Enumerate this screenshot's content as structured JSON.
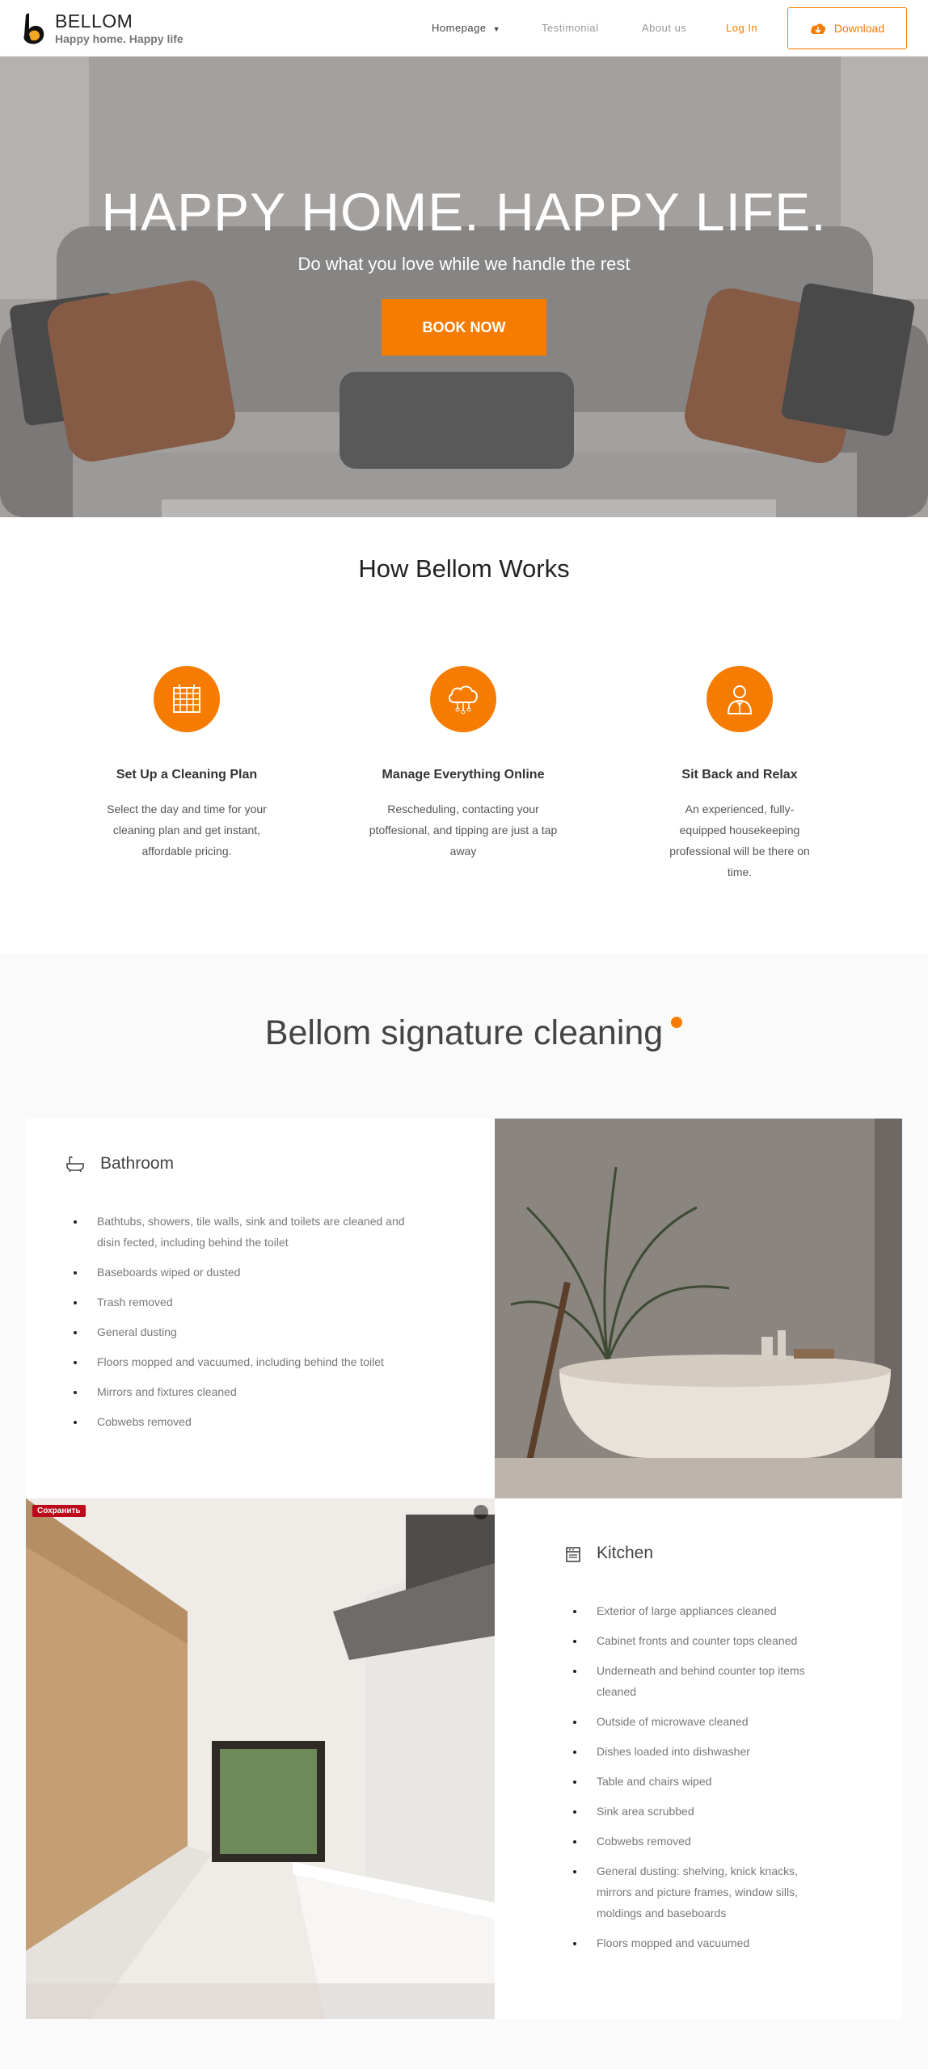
{
  "header": {
    "brand_name": "BELLOM",
    "brand_tagline": "Happy home. Happy life",
    "nav": [
      "Homepage",
      "Testimonial",
      "About us",
      "Log In"
    ],
    "download_label": "Download"
  },
  "hero": {
    "title": "HAPPY HOME. HAPPY LIFE.",
    "subtitle": "Do what you love while we handle the rest",
    "button": "BOOK NOW"
  },
  "how": {
    "title": "How Bellom Works",
    "steps": [
      {
        "icon": "calendar-icon",
        "title": "Set Up a Cleaning Plan",
        "text": "Select the day and time for your cleaning plan and get instant, affordable pricing."
      },
      {
        "icon": "cloud-icon",
        "title": "Manage Everything Online",
        "text": "Rescheduling, contacting your ptoffesional, and tipping are just a tap away"
      },
      {
        "icon": "person-icon",
        "title": "Sit Back and Relax",
        "text": "An experienced, fully-equipped housekeeping professional will be there on time."
      }
    ]
  },
  "signature": {
    "title": "Bellom signature cleaning",
    "bathroom": {
      "title": "Bathroom",
      "icon": "bathtub-icon",
      "items": [
        "Bathtubs, showers, tile walls, sink and toilets are cleaned and disin fected, including behind the toilet",
        "Baseboards wiped or dusted",
        "Trash removed",
        "General dusting",
        "Floors mopped and vacuumed, including behind the toilet",
        "Mirrors and fixtures cleaned",
        "Cobwebs removed"
      ]
    },
    "kitchen": {
      "title": "Kitchen",
      "icon": "stove-icon",
      "items": [
        "Exterior of large appliances cleaned",
        "Cabinet fronts and counter tops cleaned",
        "Underneath and behind counter top items cleaned",
        "Outside of microwave cleaned",
        "Dishes loaded into dishwasher",
        "Table and chairs wiped",
        "Sink area scrubbed",
        "Cobwebs removed",
        "General dusting: shelving, knick knacks, mirrors and picture frames, window sills, moldings and baseboards",
        "Floors mopped and vacuumed"
      ]
    },
    "pin_label": "Сохранить"
  },
  "colors": {
    "accent": "#f57c00"
  }
}
